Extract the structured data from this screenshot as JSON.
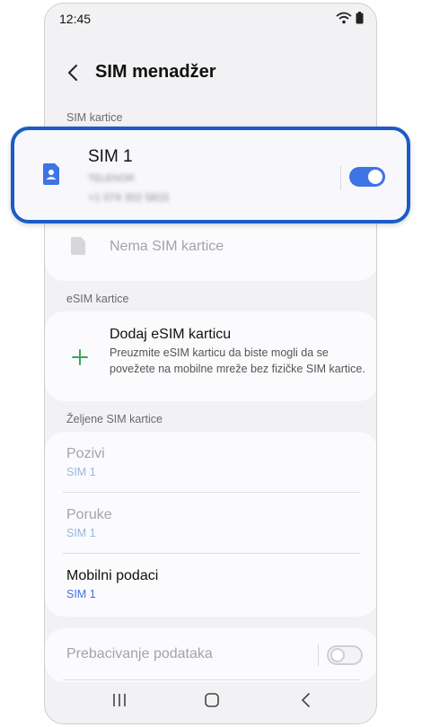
{
  "status_bar": {
    "time": "12:45"
  },
  "header": {
    "title": "SIM menadžer"
  },
  "sim_cards": {
    "section_label": "SIM kartice",
    "sim1": {
      "name": "SIM 1",
      "carrier": "TELENOR",
      "number": "+1 074 302 5815",
      "enabled": true
    },
    "sim2": {
      "name": "Nema SIM kartice"
    }
  },
  "esim": {
    "section_label": "eSIM kartice",
    "add_title": "Dodaj eSIM karticu",
    "add_description": "Preuzmite eSIM karticu da biste mogli da se povežete na mobilne mreže bez fizičke SIM kartice."
  },
  "preferred": {
    "section_label": "Željene SIM kartice",
    "calls": {
      "label": "Pozivi",
      "value": "SIM 1"
    },
    "messages": {
      "label": "Poruke",
      "value": "SIM 1"
    },
    "mobile_data": {
      "label": "Mobilni podaci",
      "value": "SIM 1"
    }
  },
  "data_switch": {
    "label": "Prebacivanje podataka",
    "enabled": false
  },
  "colors": {
    "accent": "#3e74e4",
    "highlight_border": "#1a5cc4",
    "esim_plus": "#3aa85a",
    "disabled_text": "#a4a4a8",
    "sub_disabled": "#9bb4de"
  },
  "icons": {
    "back": "chevron-left-icon",
    "sim": "sim-card-icon",
    "add": "plus-icon",
    "wifi": "wifi-icon",
    "battery": "battery-icon"
  }
}
